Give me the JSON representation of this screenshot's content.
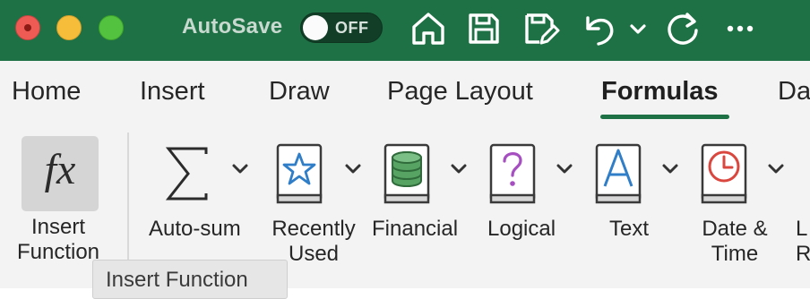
{
  "titlebar": {
    "autosave_label": "AutoSave",
    "autosave_state": "OFF",
    "accent": "#1e7145",
    "icons": [
      "home-icon",
      "save-icon",
      "save-edit-icon",
      "undo-icon",
      "undo-dropdown-icon",
      "redo-icon",
      "more-icon"
    ]
  },
  "tabs": [
    {
      "label": "Home"
    },
    {
      "label": "Insert"
    },
    {
      "label": "Draw"
    },
    {
      "label": "Page Layout"
    },
    {
      "label": "Formulas",
      "active": true
    },
    {
      "label": "Da"
    }
  ],
  "ribbon": {
    "insert_function": {
      "line1": "Insert",
      "line2": "Function"
    },
    "autosum": {
      "label": "Auto-sum"
    },
    "recently_used": {
      "line1": "Recently",
      "line2": "Used"
    },
    "financial": {
      "label": "Financial"
    },
    "logical": {
      "label": "Logical"
    },
    "text": {
      "label": "Text"
    },
    "date_time": {
      "line1": "Date &",
      "line2": "Time"
    },
    "lookup": {
      "line1": "L",
      "line2": "R"
    }
  },
  "tooltip": {
    "text": "Insert Function"
  }
}
